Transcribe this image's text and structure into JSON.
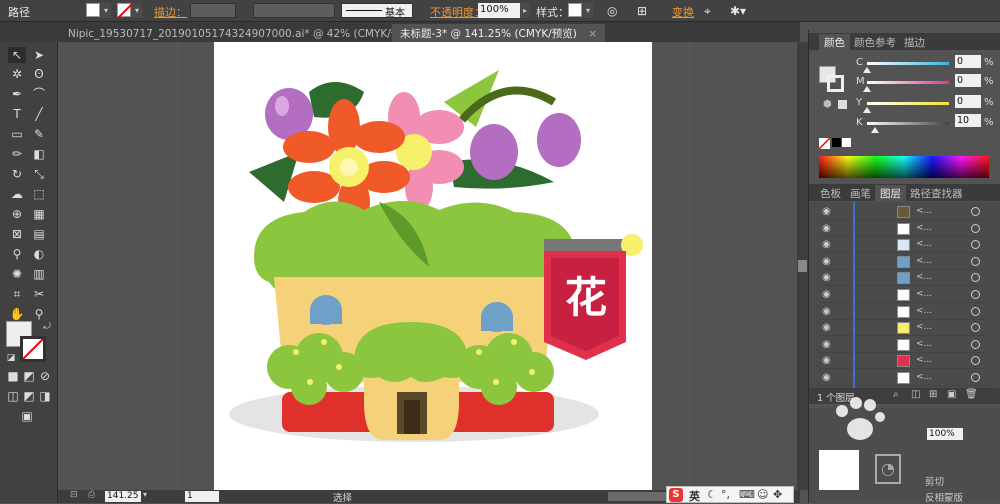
{
  "control_bar": {
    "path_label": "路径",
    "stroke_label": "描边：",
    "stroke_style": "基本",
    "opacity_label": "不透明度：",
    "opacity_value": "100%",
    "style_label": "样式：",
    "transform_label": "变换"
  },
  "tabs": [
    {
      "label": "Nipic_19530717_20190105174324907000.ai* @ 42% (CMYK/预览)",
      "active": false
    },
    {
      "label": "未标题-3* @ 141.25% (CMYK/预览)",
      "active": true
    }
  ],
  "tab_close": "×",
  "status_bar": {
    "zoom": "141.25",
    "page": "1",
    "tool_name": "选择"
  },
  "color_panel": {
    "tabs": [
      "颜色",
      "颜色参考",
      "描边"
    ],
    "channels": [
      {
        "label": "C",
        "value": "0",
        "color": "#37b6e0",
        "fraction": 0.0
      },
      {
        "label": "M",
        "value": "0",
        "color": "#e0368f",
        "fraction": 0.0
      },
      {
        "label": "Y",
        "value": "0",
        "color": "#eee535",
        "fraction": 0.0
      },
      {
        "label": "K",
        "value": "10",
        "color": "#444444",
        "fraction": 0.1
      }
    ],
    "percent_sign": "%"
  },
  "layers_panel": {
    "tabs": [
      "色板",
      "画笔",
      "图层",
      "路径查找器"
    ],
    "active_tab": "图层",
    "row_name": "<...",
    "rows": [
      {
        "thumb_color": "#6b5a3a"
      },
      {
        "thumb_color": "#ffffff"
      },
      {
        "thumb_color": "#d9e6f3"
      },
      {
        "thumb_color": "#6fa0c8"
      },
      {
        "thumb_color": "#6fa0c8"
      },
      {
        "thumb_color": "#ffffff"
      },
      {
        "thumb_color": "#ffffff"
      },
      {
        "thumb_color": "#f5f06a"
      },
      {
        "thumb_color": "#ffffff"
      },
      {
        "thumb_color": "#e0304c"
      },
      {
        "thumb_color": "#ffffff"
      }
    ],
    "footer_label": "1 个图层"
  },
  "lower_panel": {
    "opacity_value": "100%",
    "clip_label": "剪切",
    "invert_label": "反相蒙版"
  },
  "ime_bar": {
    "lang": "英"
  },
  "artwork": {
    "sign_char": "花"
  }
}
